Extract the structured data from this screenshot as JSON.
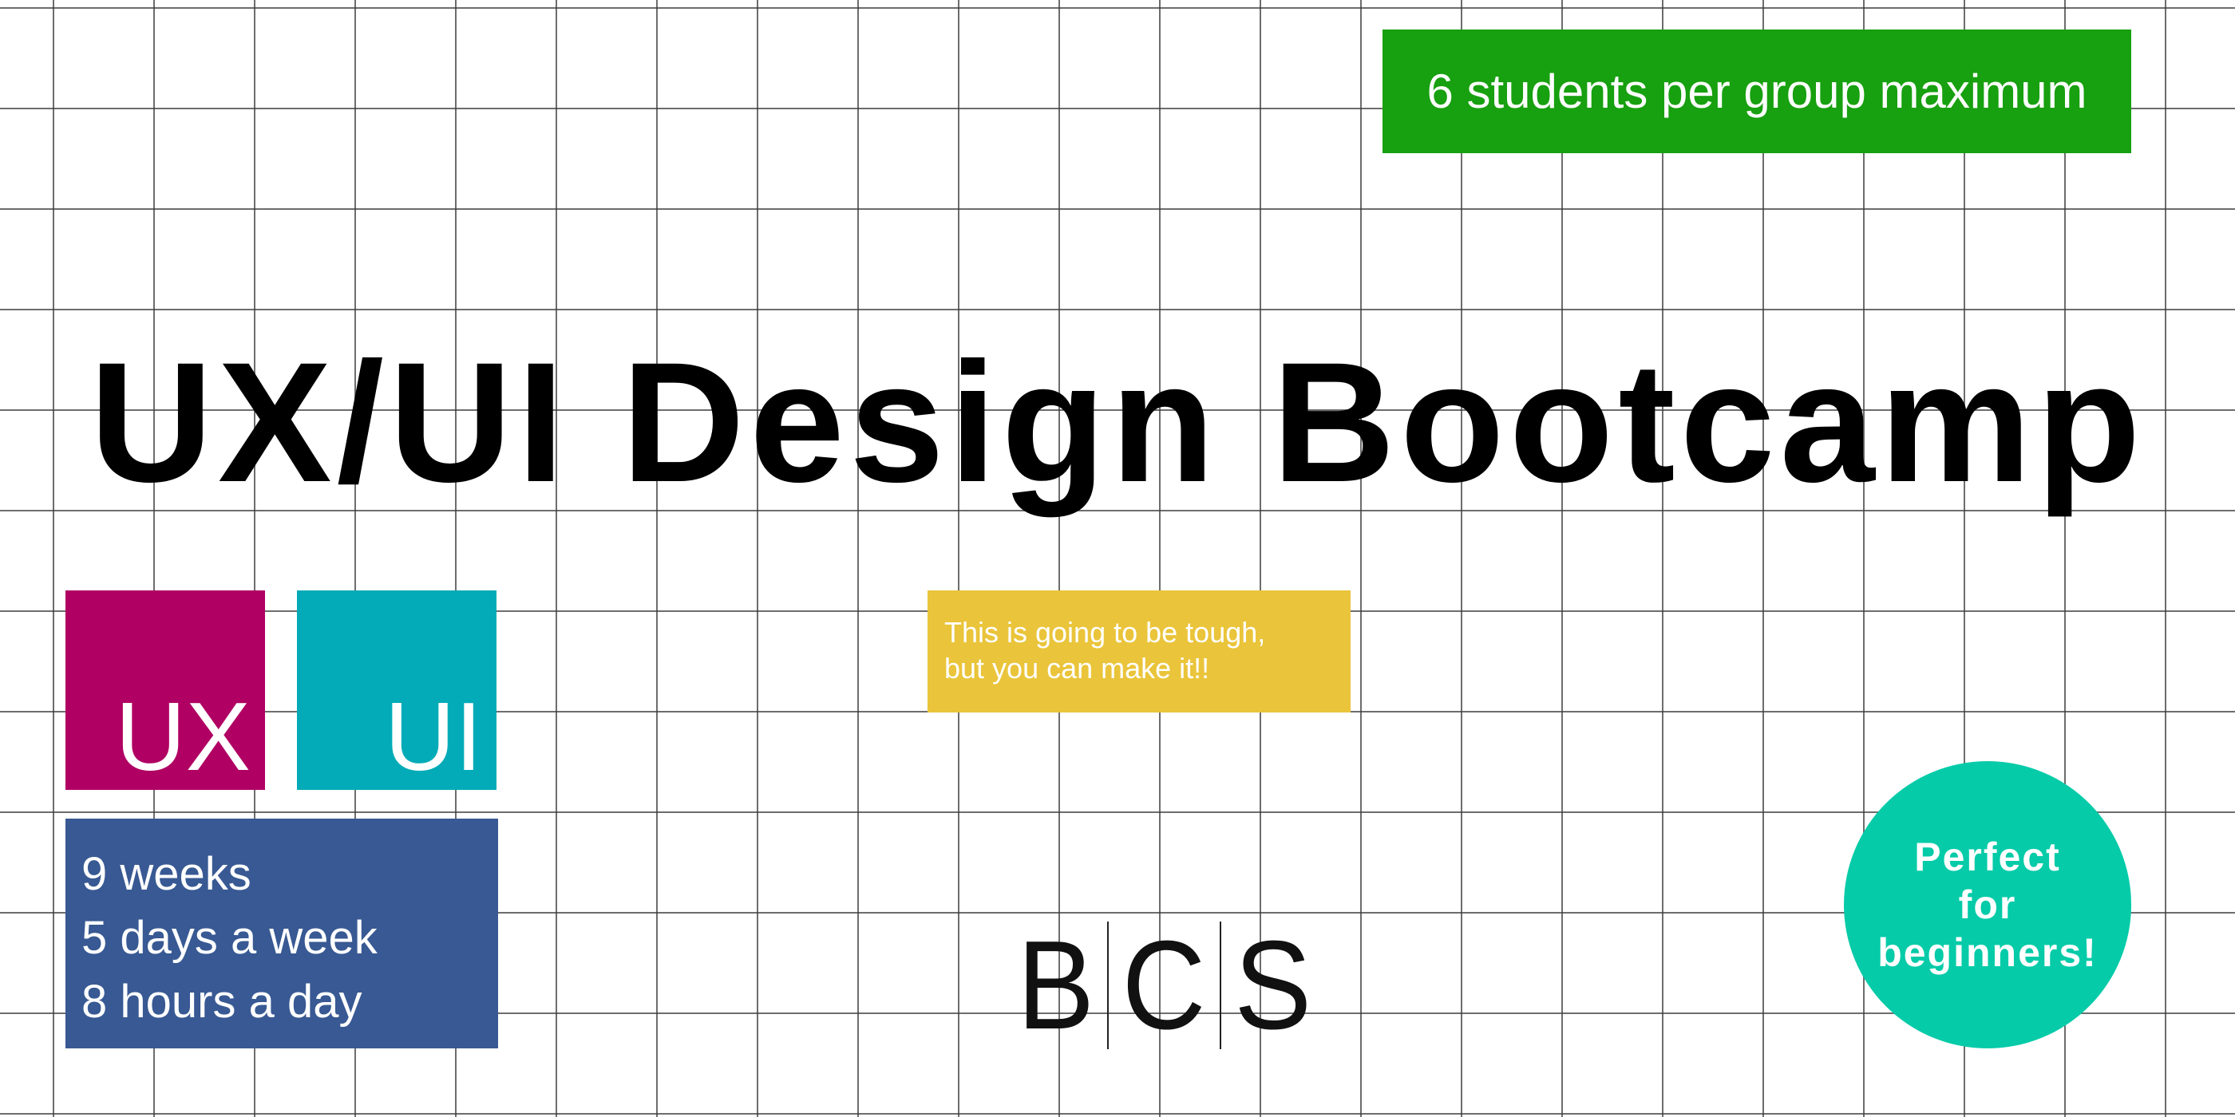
{
  "banner": {
    "text": "6 students per group maximum",
    "color": "#17a00f"
  },
  "title": "UX/UI Design Bootcamp",
  "tiles": [
    {
      "label": "UX",
      "color": "#b00063"
    },
    {
      "label": "UI",
      "color": "#02abb7"
    }
  ],
  "schedule": {
    "lines": [
      "9 weeks",
      "5 days a week",
      "8 hours a day"
    ],
    "color": "#385993"
  },
  "note": {
    "lines": [
      "This is going to be tough,",
      "but you can make it!!"
    ],
    "color": "#eac43a"
  },
  "logo": {
    "letters": [
      "B",
      "C",
      "S"
    ]
  },
  "badge": {
    "lines": [
      "Perfect",
      "for",
      "beginners!"
    ],
    "color": "#05cba8"
  }
}
